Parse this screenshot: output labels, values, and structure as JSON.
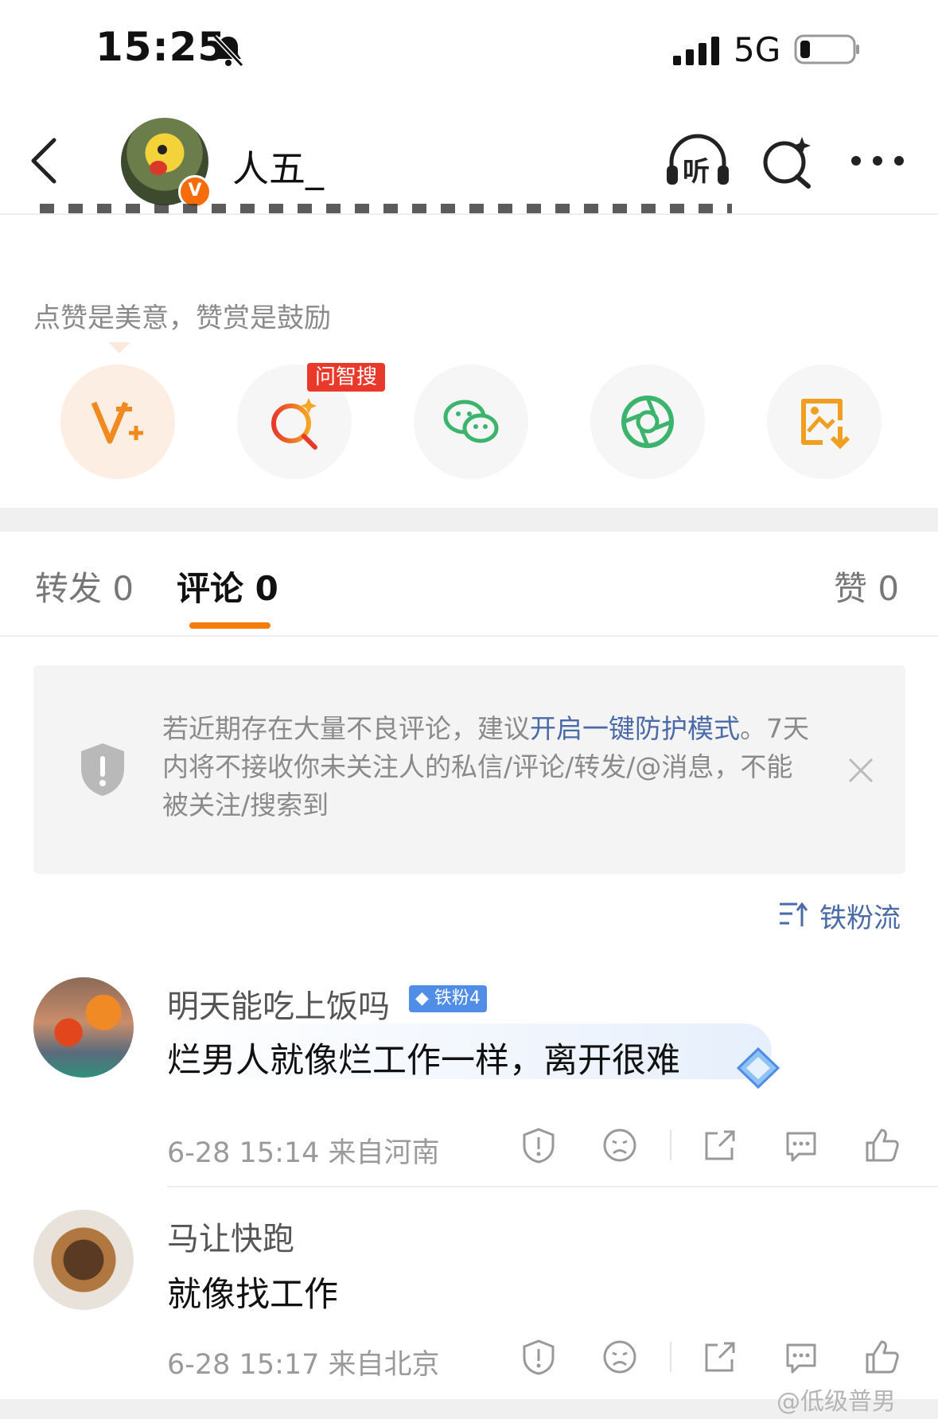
{
  "status_bar": {
    "time": "15:25",
    "network": "5G"
  },
  "header": {
    "username": "人五_",
    "verified_badge": "V",
    "listen_label": "听"
  },
  "reward": {
    "hint": "点赞是美意，赞赏是鼓励",
    "ai_badge": "问智搜",
    "actions": [
      "v-plus-icon",
      "ai-search-icon",
      "wechat-icon",
      "moments-icon",
      "save-image-icon"
    ]
  },
  "tabs": {
    "repost": "转发 0",
    "comment": "评论 0",
    "like": "赞 0"
  },
  "notice": {
    "text_before": "若近期存在大量不良评论，建议",
    "link": "开启一键防护模式",
    "text_after": "。7天内将不接收你未关注人的私信/评论/转发/@消息，不能被关注/搜索到"
  },
  "sort": {
    "label": "铁粉流"
  },
  "comments": [
    {
      "name": "明天能吃上饭吗",
      "badge": "铁粉4",
      "text": "烂男人就像烂工作一样，离开很难",
      "meta": "6-28 15:14  来自河南"
    },
    {
      "name": "马让快跑",
      "text": "就像找工作",
      "meta": "6-28 15:17  来自北京"
    }
  ],
  "watermark": "@低级普男",
  "colors": {
    "accent": "#f57c0b",
    "link": "#4a6aa8",
    "badge_red": "#e8392b"
  }
}
